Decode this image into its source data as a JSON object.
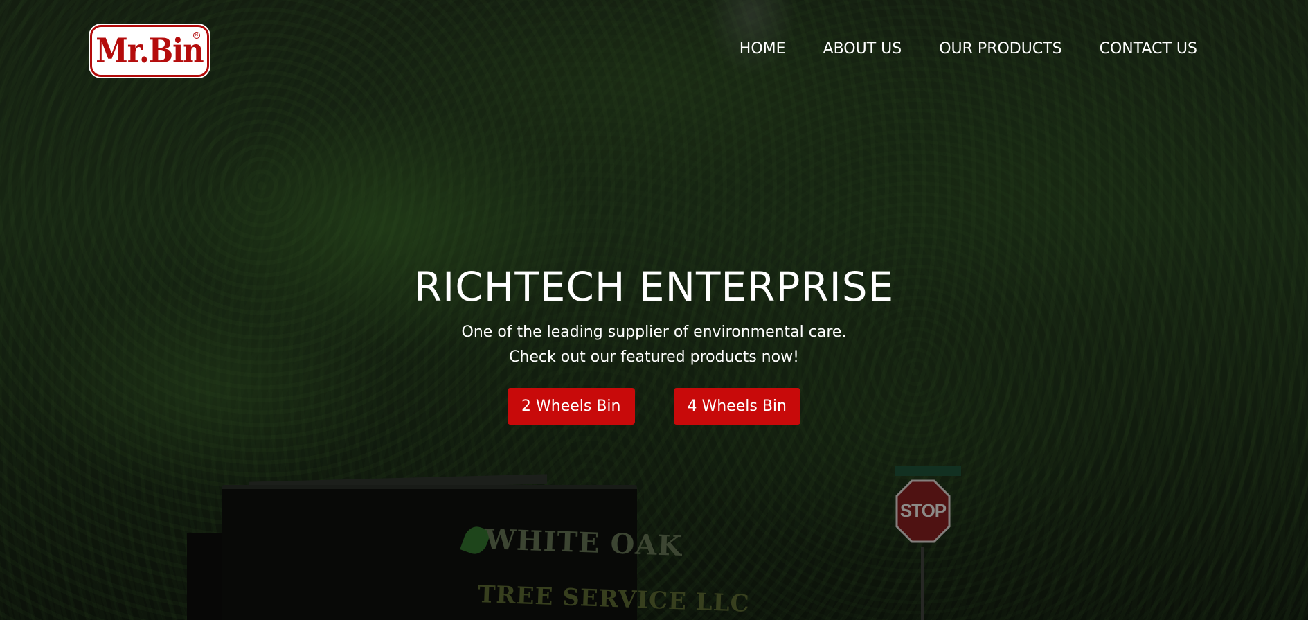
{
  "brand": {
    "logo_text": "Mr.Bin",
    "registered_mark": "R",
    "colors": {
      "brand_red": "#b40c0c",
      "button_red": "#c80a0a"
    }
  },
  "nav": {
    "items": [
      {
        "label": "HOME"
      },
      {
        "label": "ABOUT US"
      },
      {
        "label": "OUR PRODUCTS"
      },
      {
        "label": "CONTACT US"
      }
    ]
  },
  "hero": {
    "title": "RICHTECH ENTERPRISE",
    "subtitle_line1": "One of the leading supplier of environmental care.",
    "subtitle_line2": "Check out our featured products now!",
    "buttons": [
      {
        "label": "2 Wheels Bin"
      },
      {
        "label": "4 Wheels Bin"
      }
    ],
    "background": {
      "truck_text_1": "WHITE OAK",
      "truck_text_2": "TREE SERVICE LLC",
      "stop_sign_text": "STOP"
    }
  }
}
